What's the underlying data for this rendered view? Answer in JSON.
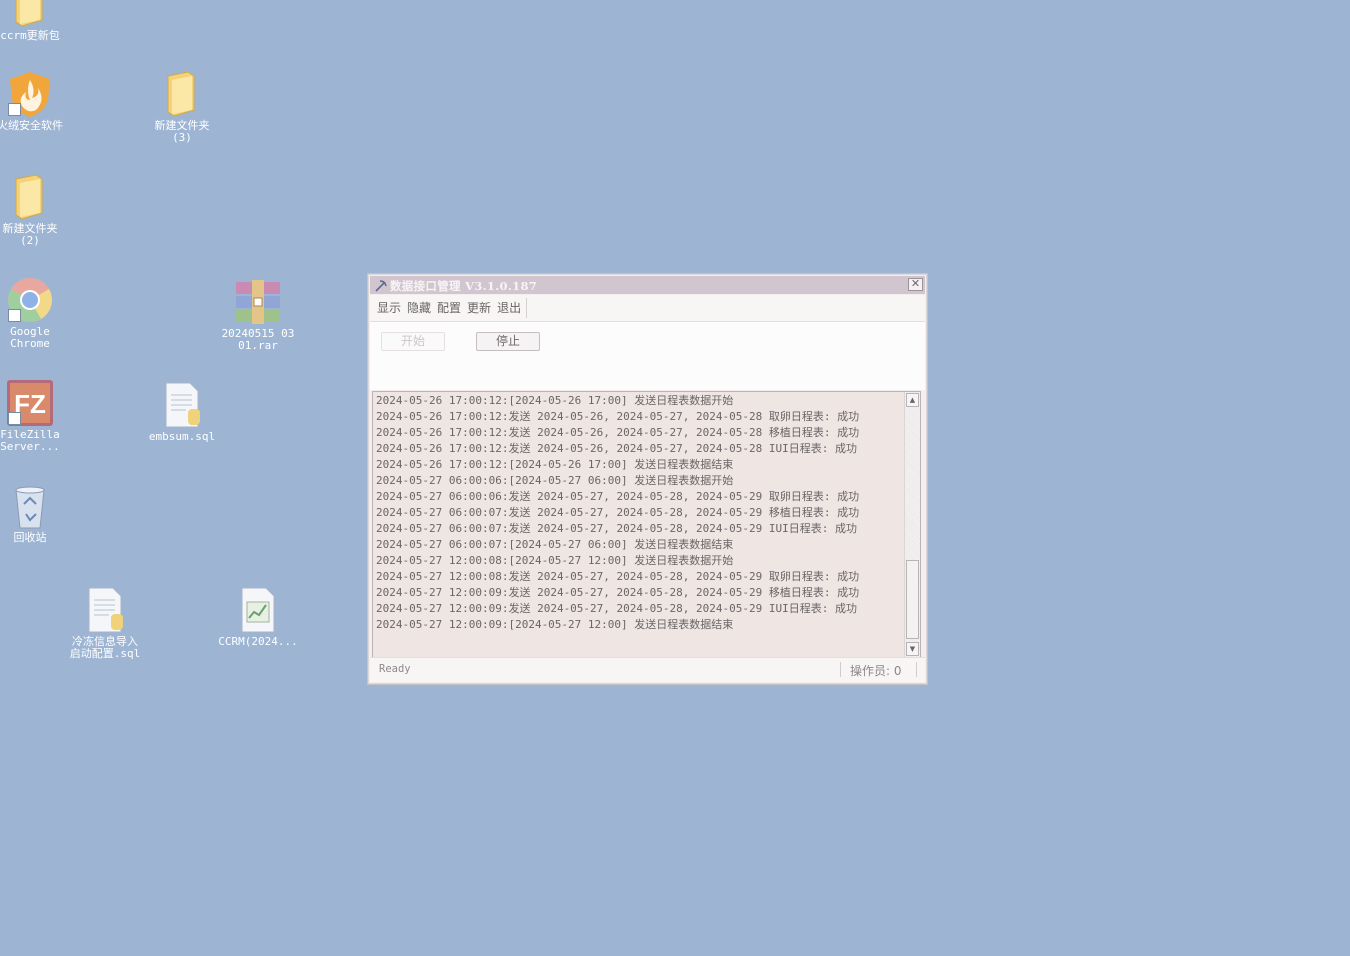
{
  "desktop": {
    "icons": [
      {
        "label": "ccrm更新包",
        "kind": "folder"
      },
      {
        "label": "火绒安全软件",
        "kind": "huorong"
      },
      {
        "label": "新建文件夹\n(3)",
        "kind": "folder"
      },
      {
        "label": "新建文件夹\n(2)",
        "kind": "folder"
      },
      {
        "label": "Google\nChrome",
        "kind": "chrome"
      },
      {
        "label": "20240515 03\n01.rar",
        "kind": "rar"
      },
      {
        "label": "FileZilla\nServer...",
        "kind": "filezilla"
      },
      {
        "label": "embsum.sql",
        "kind": "sqlfile"
      },
      {
        "label": "回收站",
        "kind": "recycle"
      },
      {
        "label": "冷冻信息导入\n启动配置.sql",
        "kind": "sqlfile"
      },
      {
        "label": "CCRM(2024...",
        "kind": "chartfile"
      }
    ]
  },
  "window": {
    "title": "数据接口管理 V3.1.0.187",
    "close_label": "✕",
    "menu": [
      "显示",
      "隐藏",
      "配置",
      "更新",
      "退出"
    ],
    "toolbar": {
      "start_label": "开始",
      "stop_label": "停止"
    },
    "log": [
      "2024-05-26 17:00:12:[2024-05-26 17:00] 发送日程表数据开始",
      "2024-05-26 17:00:12:发送 2024-05-26, 2024-05-27, 2024-05-28 取卵日程表: 成功",
      "2024-05-26 17:00:12:发送 2024-05-26, 2024-05-27, 2024-05-28 移植日程表: 成功",
      "2024-05-26 17:00:12:发送 2024-05-26, 2024-05-27, 2024-05-28 IUI日程表: 成功",
      "2024-05-26 17:00:12:[2024-05-26 17:00] 发送日程表数据结束",
      "2024-05-27 06:00:06:[2024-05-27 06:00] 发送日程表数据开始",
      "2024-05-27 06:00:06:发送 2024-05-27, 2024-05-28, 2024-05-29 取卵日程表: 成功",
      "2024-05-27 06:00:07:发送 2024-05-27, 2024-05-28, 2024-05-29 移植日程表: 成功",
      "2024-05-27 06:00:07:发送 2024-05-27, 2024-05-28, 2024-05-29 IUI日程表: 成功",
      "2024-05-27 06:00:07:[2024-05-27 06:00] 发送日程表数据结束",
      "2024-05-27 12:00:08:[2024-05-27 12:00] 发送日程表数据开始",
      "2024-05-27 12:00:08:发送 2024-05-27, 2024-05-28, 2024-05-29 取卵日程表: 成功",
      "2024-05-27 12:00:09:发送 2024-05-27, 2024-05-28, 2024-05-29 移植日程表: 成功",
      "2024-05-27 12:00:09:发送 2024-05-27, 2024-05-28, 2024-05-29 IUI日程表: 成功",
      "2024-05-27 12:00:09:[2024-05-27 12:00] 发送日程表数据结束"
    ],
    "status": {
      "text": "Ready",
      "operator": "操作员: 0"
    }
  }
}
